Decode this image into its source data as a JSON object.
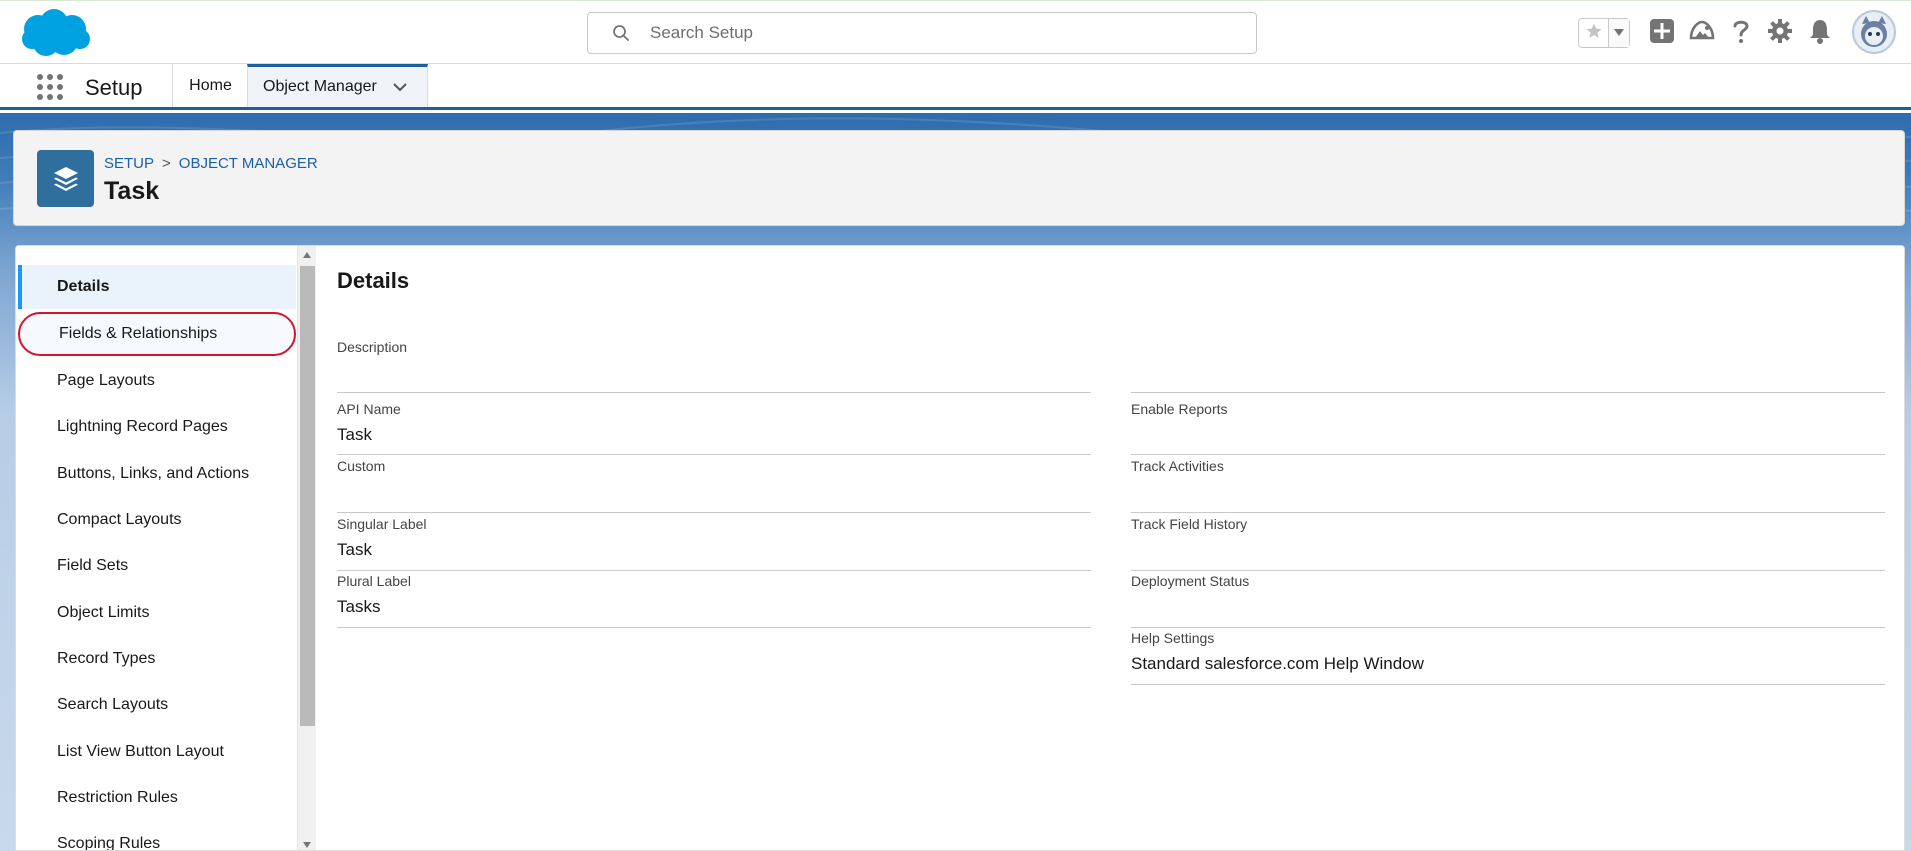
{
  "header": {
    "search_placeholder": "Search Setup"
  },
  "icons": {
    "logo": "salesforce-cloud-logo",
    "favorites": "star-icon",
    "favorites_menu": "chevron-down-icon",
    "global_actions": "plus-icon",
    "trailhead": "trailhead-icon",
    "help": "question-icon",
    "setup": "gear-icon",
    "notifications": "bell-icon",
    "avatar": "user-avatar"
  },
  "context_bar": {
    "app_name": "Setup",
    "tabs": [
      {
        "label": "Home"
      },
      {
        "label": "Object Manager"
      }
    ]
  },
  "page_header": {
    "breadcrumb": [
      "SETUP",
      "OBJECT MANAGER"
    ],
    "separator": ">",
    "title": "Task"
  },
  "sidebar": {
    "items": [
      {
        "label": "Details"
      },
      {
        "label": "Fields & Relationships"
      },
      {
        "label": "Page Layouts"
      },
      {
        "label": "Lightning Record Pages"
      },
      {
        "label": "Buttons, Links, and Actions"
      },
      {
        "label": "Compact Layouts"
      },
      {
        "label": "Field Sets"
      },
      {
        "label": "Object Limits"
      },
      {
        "label": "Record Types"
      },
      {
        "label": "Search Layouts"
      },
      {
        "label": "List View Button Layout"
      },
      {
        "label": "Restriction Rules"
      },
      {
        "label": "Scoping Rules"
      }
    ]
  },
  "details": {
    "title": "Details",
    "left": [
      {
        "label": "Description",
        "value": ""
      },
      {
        "label": "API Name",
        "value": "Task"
      },
      {
        "label": "Custom",
        "value": ""
      },
      {
        "label": "Singular Label",
        "value": "Task"
      },
      {
        "label": "Plural Label",
        "value": "Tasks"
      }
    ],
    "right": [
      {
        "label": "Enable Reports",
        "value": ""
      },
      {
        "label": "Track Activities",
        "value": ""
      },
      {
        "label": "Track Field History",
        "value": ""
      },
      {
        "label": "Deployment Status",
        "value": ""
      },
      {
        "label": "Help Settings",
        "value": "Standard salesforce.com Help Window"
      }
    ]
  },
  "colors": {
    "brand_blue": "#1b5f9e",
    "highlight_ring": "#d0152c",
    "active_accent": "#1b96ff"
  }
}
